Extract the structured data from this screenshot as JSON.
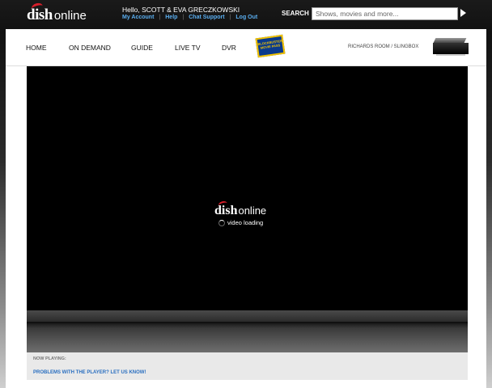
{
  "header": {
    "logo": {
      "dish": "dish",
      "online": "online"
    },
    "greeting": "Hello, SCOTT & EVA GRECZKOWSKI",
    "account_links": [
      "My Account",
      "Help",
      "Chat Support",
      "Log Out"
    ],
    "search": {
      "label": "SEARCH",
      "placeholder": "Shows, movies and more..."
    }
  },
  "nav": {
    "items": [
      "HOME",
      "ON DEMAND",
      "GUIDE",
      "LIVE TV",
      "DVR"
    ],
    "promo_badge": [
      "BLOCKBUSTER",
      "MOVIE PASS"
    ],
    "room_label": "RICHARDS ROOM / SLINGBOX"
  },
  "player": {
    "logo": {
      "dish": "dish",
      "online": "online"
    },
    "status": "video loading"
  },
  "footer": {
    "now_playing_label": "NOW PLAYING:",
    "feedback_link": "PROBLEMS WITH THE PLAYER? LET US KNOW!"
  },
  "colors": {
    "accent_red": "#d81e2a",
    "link_blue": "#5aaef0",
    "video_bg": "#000000"
  },
  "icons": {
    "search_go": "play-arrow-icon",
    "device": "slingbox-icon",
    "loading": "spinner-icon"
  }
}
